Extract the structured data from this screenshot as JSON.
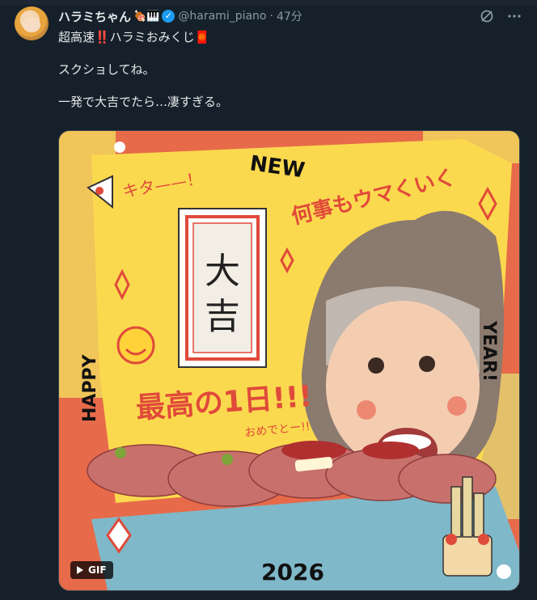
{
  "post": {
    "author_name": "ハラミちゃん",
    "author_emoji": "🍖🎹",
    "handle": "@harami_piano",
    "separator": "·",
    "time": "47分",
    "lines": [
      "超高速‼️ハラミおみくじ🧧",
      "スクショしてね。",
      "一発で大吉でたら…凄すぎる。"
    ]
  },
  "media": {
    "badge": "GIF",
    "card_top": "大",
    "card_bottom": "吉",
    "text_new": "NEW",
    "text_kita": "キタ——！",
    "text_nanigoto": "何事もウマくいく",
    "text_happy": "HAPPY",
    "text_year": "YEAR!",
    "text_saikou": "最高の1日!!!",
    "text_omedeto": "おめでとー!!",
    "text_year_num": "2026"
  },
  "icons": {
    "verified": "verified-badge-icon",
    "grok": "grok-icon",
    "more": "more-icon",
    "play": "play-icon"
  },
  "colors": {
    "background": "#15202b",
    "verified": "#1d9bf0",
    "muted": "#8b98a5",
    "media_orange": "#e76a4a",
    "media_yellow": "#fbd94e"
  }
}
